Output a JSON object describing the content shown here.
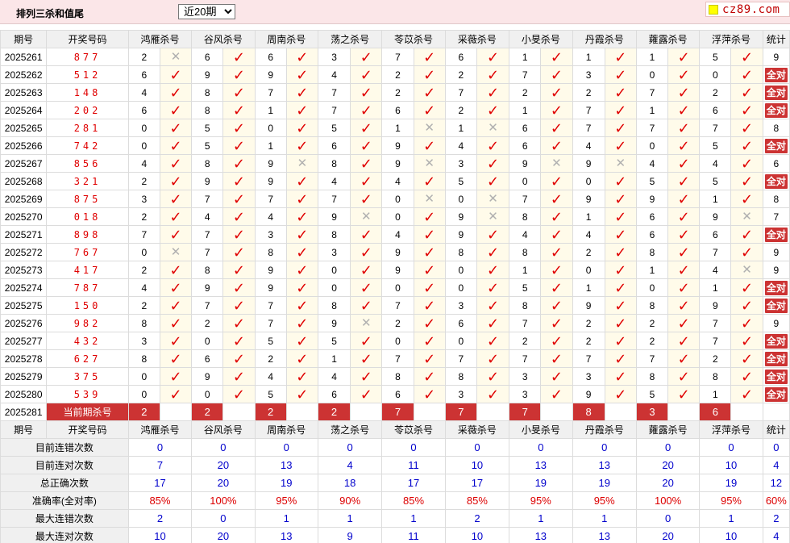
{
  "header": {
    "title": "排列三杀和值尾",
    "select_options": [
      "近20期"
    ],
    "selected": "近20期",
    "logo_text": "cz89.com"
  },
  "columns": {
    "period": "期号",
    "draw": "开奖号码",
    "experts": [
      "鸿雁杀号",
      "谷风杀号",
      "周南杀号",
      "荡之杀号",
      "苓苡杀号",
      "采薇杀号",
      "小旻杀号",
      "丹霞杀号",
      "蕹露杀号",
      "浮萍杀号"
    ],
    "stat": "统计"
  },
  "symbols": {
    "ok": "✓",
    "bad": "✕"
  },
  "all_correct_label": "全对",
  "rows": [
    {
      "period": "2025261",
      "draw": "877",
      "kills": [
        "2",
        "6",
        "6",
        "3",
        "7",
        "6",
        "1",
        "1",
        "1",
        "5"
      ],
      "results": [
        0,
        1,
        1,
        1,
        1,
        1,
        1,
        1,
        1,
        1
      ],
      "stat": "9"
    },
    {
      "period": "2025262",
      "draw": "512",
      "kills": [
        "6",
        "9",
        "9",
        "4",
        "2",
        "2",
        "7",
        "3",
        "0",
        "0"
      ],
      "results": [
        1,
        1,
        1,
        1,
        1,
        1,
        1,
        1,
        1,
        1
      ],
      "stat": "全对"
    },
    {
      "period": "2025263",
      "draw": "148",
      "kills": [
        "4",
        "8",
        "7",
        "7",
        "2",
        "7",
        "2",
        "2",
        "7",
        "2"
      ],
      "results": [
        1,
        1,
        1,
        1,
        1,
        1,
        1,
        1,
        1,
        1
      ],
      "stat": "全对"
    },
    {
      "period": "2025264",
      "draw": "202",
      "kills": [
        "6",
        "8",
        "1",
        "7",
        "6",
        "2",
        "1",
        "7",
        "1",
        "6"
      ],
      "results": [
        1,
        1,
        1,
        1,
        1,
        1,
        1,
        1,
        1,
        1
      ],
      "stat": "全对"
    },
    {
      "period": "2025265",
      "draw": "281",
      "kills": [
        "0",
        "5",
        "0",
        "5",
        "1",
        "1",
        "6",
        "7",
        "7",
        "7"
      ],
      "results": [
        1,
        1,
        1,
        1,
        0,
        0,
        1,
        1,
        1,
        1
      ],
      "stat": "8"
    },
    {
      "period": "2025266",
      "draw": "742",
      "kills": [
        "0",
        "5",
        "1",
        "6",
        "9",
        "4",
        "6",
        "4",
        "0",
        "5"
      ],
      "results": [
        1,
        1,
        1,
        1,
        1,
        1,
        1,
        1,
        1,
        1
      ],
      "stat": "全对"
    },
    {
      "period": "2025267",
      "draw": "856",
      "kills": [
        "4",
        "8",
        "9",
        "8",
        "9",
        "3",
        "9",
        "9",
        "4",
        "4"
      ],
      "results": [
        1,
        1,
        0,
        1,
        0,
        1,
        0,
        0,
        1,
        1
      ],
      "stat": "6"
    },
    {
      "period": "2025268",
      "draw": "321",
      "kills": [
        "2",
        "9",
        "9",
        "4",
        "4",
        "5",
        "0",
        "0",
        "5",
        "5"
      ],
      "results": [
        1,
        1,
        1,
        1,
        1,
        1,
        1,
        1,
        1,
        1
      ],
      "stat": "全对"
    },
    {
      "period": "2025269",
      "draw": "875",
      "kills": [
        "3",
        "7",
        "7",
        "7",
        "0",
        "0",
        "7",
        "9",
        "9",
        "1"
      ],
      "results": [
        1,
        1,
        1,
        1,
        0,
        0,
        1,
        1,
        1,
        1
      ],
      "stat": "8"
    },
    {
      "period": "2025270",
      "draw": "018",
      "kills": [
        "2",
        "4",
        "4",
        "9",
        "0",
        "9",
        "8",
        "1",
        "6",
        "9"
      ],
      "results": [
        1,
        1,
        1,
        0,
        1,
        0,
        1,
        1,
        1,
        0
      ],
      "stat": "7"
    },
    {
      "period": "2025271",
      "draw": "898",
      "kills": [
        "7",
        "7",
        "3",
        "8",
        "4",
        "9",
        "4",
        "4",
        "6",
        "6"
      ],
      "results": [
        1,
        1,
        1,
        1,
        1,
        1,
        1,
        1,
        1,
        1
      ],
      "stat": "全对"
    },
    {
      "period": "2025272",
      "draw": "767",
      "kills": [
        "0",
        "7",
        "8",
        "3",
        "9",
        "8",
        "8",
        "2",
        "8",
        "7"
      ],
      "results": [
        0,
        1,
        1,
        1,
        1,
        1,
        1,
        1,
        1,
        1
      ],
      "stat": "9"
    },
    {
      "period": "2025273",
      "draw": "417",
      "kills": [
        "2",
        "8",
        "9",
        "0",
        "9",
        "0",
        "1",
        "0",
        "1",
        "4"
      ],
      "results": [
        1,
        1,
        1,
        1,
        1,
        1,
        1,
        1,
        1,
        0
      ],
      "stat": "9"
    },
    {
      "period": "2025274",
      "draw": "787",
      "kills": [
        "4",
        "9",
        "9",
        "0",
        "0",
        "0",
        "5",
        "1",
        "0",
        "1"
      ],
      "results": [
        1,
        1,
        1,
        1,
        1,
        1,
        1,
        1,
        1,
        1
      ],
      "stat": "全对"
    },
    {
      "period": "2025275",
      "draw": "150",
      "kills": [
        "2",
        "7",
        "7",
        "8",
        "7",
        "3",
        "8",
        "9",
        "8",
        "9"
      ],
      "results": [
        1,
        1,
        1,
        1,
        1,
        1,
        1,
        1,
        1,
        1
      ],
      "stat": "全对"
    },
    {
      "period": "2025276",
      "draw": "982",
      "kills": [
        "8",
        "2",
        "7",
        "9",
        "2",
        "6",
        "7",
        "2",
        "2",
        "7"
      ],
      "results": [
        1,
        1,
        1,
        0,
        1,
        1,
        1,
        1,
        1,
        1
      ],
      "stat": "9"
    },
    {
      "period": "2025277",
      "draw": "432",
      "kills": [
        "3",
        "0",
        "5",
        "5",
        "0",
        "0",
        "2",
        "2",
        "2",
        "7"
      ],
      "results": [
        1,
        1,
        1,
        1,
        1,
        1,
        1,
        1,
        1,
        1
      ],
      "stat": "全对"
    },
    {
      "period": "2025278",
      "draw": "627",
      "kills": [
        "8",
        "6",
        "2",
        "1",
        "7",
        "7",
        "7",
        "7",
        "7",
        "2"
      ],
      "results": [
        1,
        1,
        1,
        1,
        1,
        1,
        1,
        1,
        1,
        1
      ],
      "stat": "全对"
    },
    {
      "period": "2025279",
      "draw": "375",
      "kills": [
        "0",
        "9",
        "4",
        "4",
        "8",
        "8",
        "3",
        "3",
        "8",
        "8"
      ],
      "results": [
        1,
        1,
        1,
        1,
        1,
        1,
        1,
        1,
        1,
        1
      ],
      "stat": "全对"
    },
    {
      "period": "2025280",
      "draw": "539",
      "kills": [
        "0",
        "0",
        "5",
        "6",
        "6",
        "3",
        "3",
        "9",
        "5",
        "1"
      ],
      "results": [
        1,
        1,
        1,
        1,
        1,
        1,
        1,
        1,
        1,
        1
      ],
      "stat": "全对"
    }
  ],
  "current": {
    "period": "2025281",
    "label": "当前期杀号",
    "kills": [
      "2",
      "2",
      "2",
      "2",
      "7",
      "7",
      "7",
      "8",
      "3",
      "6"
    ]
  },
  "stats": [
    {
      "label": "目前连错次数",
      "values": [
        "0",
        "0",
        "0",
        "0",
        "0",
        "0",
        "0",
        "0",
        "0",
        "0"
      ],
      "total": "0"
    },
    {
      "label": "目前连对次数",
      "values": [
        "7",
        "20",
        "13",
        "4",
        "11",
        "10",
        "13",
        "13",
        "20",
        "10"
      ],
      "total": "4"
    },
    {
      "label": "总正确次数",
      "values": [
        "17",
        "20",
        "19",
        "18",
        "17",
        "17",
        "19",
        "19",
        "20",
        "19"
      ],
      "total": "12"
    },
    {
      "label": "准确率(全对率)",
      "values": [
        "85%",
        "100%",
        "95%",
        "90%",
        "85%",
        "85%",
        "95%",
        "95%",
        "100%",
        "95%"
      ],
      "total": "60%"
    },
    {
      "label": "最大连错次数",
      "values": [
        "2",
        "0",
        "1",
        "1",
        "1",
        "2",
        "1",
        "1",
        "0",
        "1"
      ],
      "total": "2"
    },
    {
      "label": "最大连对次数",
      "values": [
        "10",
        "20",
        "13",
        "9",
        "11",
        "10",
        "13",
        "13",
        "20",
        "10"
      ],
      "total": "4"
    }
  ]
}
